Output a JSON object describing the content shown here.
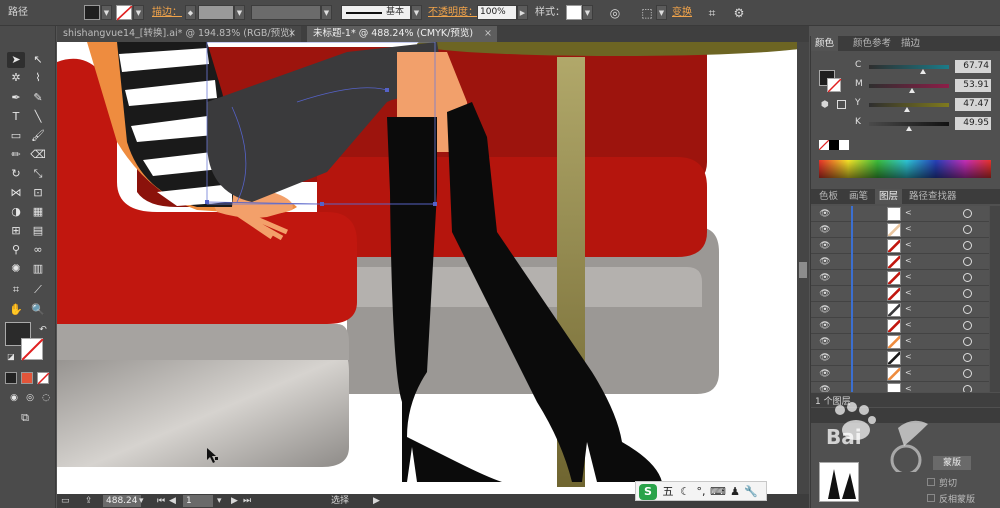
{
  "control_bar": {
    "label_path": "路径",
    "label_stroke": "描边：",
    "stroke_style": "基本",
    "label_opacity": "不透明度：",
    "opacity_value": "100%",
    "label_style": "样式：",
    "label_transform": "变换"
  },
  "documents": {
    "tabs": [
      {
        "label": "shishangvue14_[转换].ai* @ 194.83% (RGB/预览)",
        "active": false
      },
      {
        "label": "未标题-1* @ 488.24% (CMYK/预览)",
        "active": true
      }
    ],
    "close_glyph": "×"
  },
  "status_bar": {
    "zoom": "488.24",
    "page": "1",
    "mode": "选择"
  },
  "ime": {
    "logo": "S",
    "mode": "五"
  },
  "color_panel": {
    "tabs": [
      "颜色",
      "颜色参考",
      "描边"
    ],
    "channels": [
      {
        "label": "C",
        "value": "67.74",
        "fraction": 0.68
      },
      {
        "label": "M",
        "value": "53.91",
        "fraction": 0.54
      },
      {
        "label": "Y",
        "value": "47.47",
        "fraction": 0.47
      },
      {
        "label": "K",
        "value": "49.95",
        "fraction": 0.5
      }
    ]
  },
  "layers_panel": {
    "tabs": [
      "色板",
      "画笔",
      "图层",
      "路径查找器"
    ],
    "layer_count": "1 个图层",
    "row_count": 12
  },
  "transparency_panel": {
    "label_mask": "蒙版",
    "label_clip": "剪切",
    "label_invert": "反相蒙版"
  },
  "colors": {
    "accent_orange": "#f0a34a",
    "seat_red": "#c1170f",
    "sofa_gray": "#9b9895"
  }
}
